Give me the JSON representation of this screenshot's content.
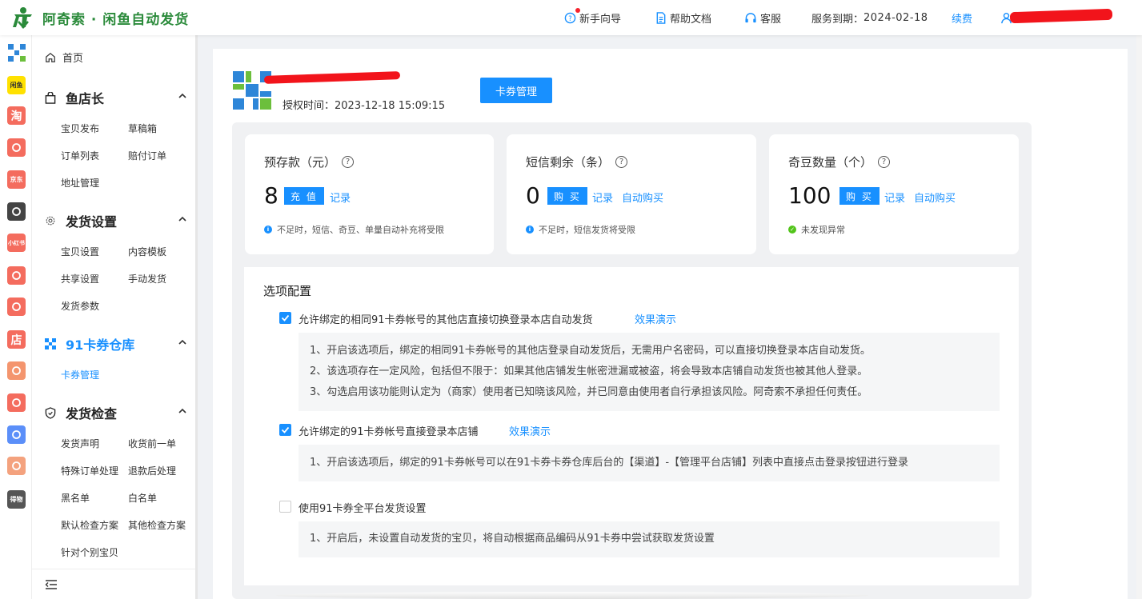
{
  "header": {
    "brand_title": "阿奇索 · 闲鱼自动发货",
    "nav": {
      "guide": "新手向导",
      "help": "帮助文档",
      "service": "客服",
      "expiry_label": "服务到期：",
      "expiry_date": "2024-02-18",
      "renew": "续费"
    }
  },
  "rail_icons": [
    {
      "name": "qr-grid-icon",
      "text": "",
      "color": "#2e86d8"
    },
    {
      "name": "xianyu-app-icon",
      "text": "闲鱼",
      "color": "#ffe100"
    },
    {
      "name": "taobao-app-icon",
      "text": "淘",
      "color": "#f46c5e"
    },
    {
      "name": "pinduoduo-app-icon",
      "text": "",
      "color": "#f46c5e"
    },
    {
      "name": "jd-app-icon",
      "text": "京东",
      "color": "#f46c5e"
    },
    {
      "name": "douyin-app-icon",
      "text": "",
      "color": "#444"
    },
    {
      "name": "xiaohongshu-app-icon",
      "text": "小红书",
      "color": "#f46c5e"
    },
    {
      "name": "kuaishou-app-icon",
      "text": "",
      "color": "#f46c5e"
    },
    {
      "name": "thumb-app-icon",
      "text": "",
      "color": "#f46c5e"
    },
    {
      "name": "shop-app-icon",
      "text": "店",
      "color": "#f46c5e"
    },
    {
      "name": "bag-app-icon",
      "text": "",
      "color": "#f4956e"
    },
    {
      "name": "shopee-app-icon",
      "text": "",
      "color": "#f46c5e"
    },
    {
      "name": "link-app-icon",
      "text": "",
      "color": "#5b8ff9"
    },
    {
      "name": "gift-app-icon",
      "text": "",
      "color": "#f4a27e"
    },
    {
      "name": "dewu-app-icon",
      "text": "得物",
      "color": "#555"
    }
  ],
  "sidebar": {
    "home": "首页",
    "groups": [
      {
        "label": "鱼店长",
        "items": [
          "宝贝发布",
          "草稿箱",
          "订单列表",
          "赔付订单",
          "地址管理"
        ]
      },
      {
        "label": "发货设置",
        "items": [
          "宝贝设置",
          "内容模板",
          "共享设置",
          "手动发货",
          "发货参数"
        ]
      },
      {
        "label": "91卡券仓库",
        "items": [
          "卡券管理"
        ]
      },
      {
        "label": "发货检查",
        "items": [
          "发货声明",
          "收货前一单",
          "特殊订单处理",
          "退款后处理",
          "黑名单",
          "白名单",
          "默认检查方案",
          "其他检查方案",
          "针对个别宝贝"
        ]
      }
    ]
  },
  "shop": {
    "auth_label": "授权时间：",
    "auth_time": "2023-12-18 15:09:15",
    "card_button": "卡券管理"
  },
  "stats": [
    {
      "title": "预存款（元）",
      "value": "8",
      "button": "充 值",
      "links": [
        "记录"
      ],
      "note": "不足时，短信、奇豆、单量自动补充将受限",
      "note_type": "info"
    },
    {
      "title": "短信剩余（条）",
      "value": "0",
      "button": "购 买",
      "links": [
        "记录",
        "自动购买"
      ],
      "note": "不足时，短信发货将受限",
      "note_type": "info"
    },
    {
      "title": "奇豆数量（个）",
      "value": "100",
      "button": "购 买",
      "links": [
        "记录",
        "自动购买"
      ],
      "note": "未发现异常",
      "note_type": "ok"
    }
  ],
  "options": {
    "title": "选项配置",
    "items": [
      {
        "checked": true,
        "label": "允许绑定的相同91卡券帐号的其他店直接切换登录本店自动发货",
        "demo": "效果演示",
        "desc": [
          "1、开启该选项后，绑定的相同91卡券帐号的其他店登录自动发货后，无需用户名密码，可以直接切换登录本店自动发货。",
          "2、该选项存在一定风险，包括但不限于：如果其他店铺发生帐密泄漏或被盗，将会导致本店铺自动发货也被其他人登录。",
          "3、勾选启用该功能则认定为（商家）使用者已知晓该风险，并已同意由使用者自行承担该风险。阿奇索不承担任何责任。"
        ]
      },
      {
        "checked": true,
        "label": "允许绑定的91卡券帐号直接登录本店铺",
        "demo": "效果演示",
        "desc": [
          "1、开启该选项后，绑定的91卡券帐号可以在91卡券卡券仓库后台的【渠道】-【管理平台店铺】列表中直接点击登录按钮进行登录"
        ]
      },
      {
        "checked": false,
        "label": "使用91卡券全平台发货设置",
        "demo": "",
        "desc": [
          "1、开启后，未设置自动发货的宝贝，将自动根据商品编码从91卡券中尝试获取发货设置"
        ]
      }
    ]
  },
  "colors": {
    "primary": "#1890ff",
    "brand": "#2a8a3a",
    "ok": "#52c41a"
  }
}
